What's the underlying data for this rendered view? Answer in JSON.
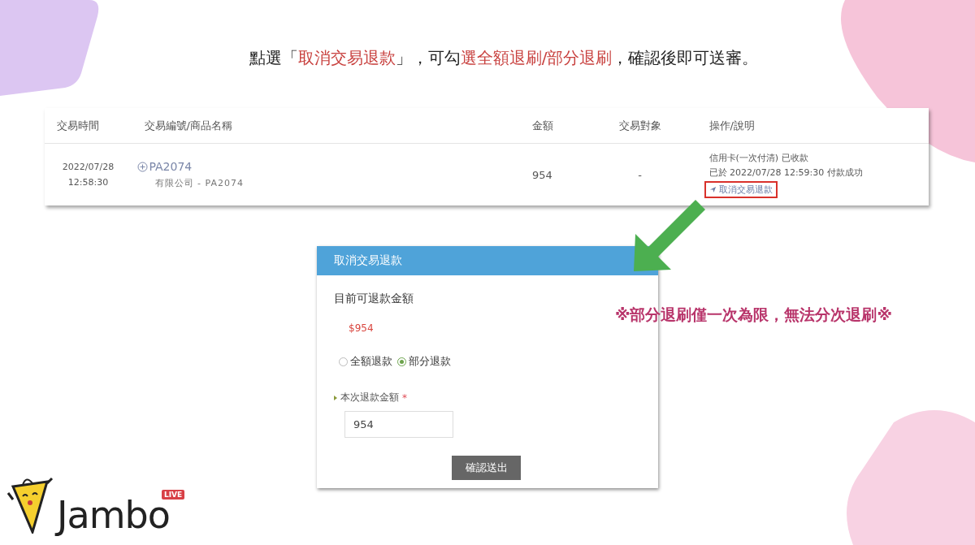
{
  "headline": [
    {
      "text": "點選「",
      "highlight": false
    },
    {
      "text": "取消交易退款",
      "highlight": true
    },
    {
      "text": "」，可勾",
      "highlight": false
    },
    {
      "text": "選全額退刷/部分退刷",
      "highlight": true
    },
    {
      "text": "，確認後即可送審。",
      "highlight": false
    }
  ],
  "table": {
    "columns": [
      "交易時間",
      "交易編號/商品名稱",
      "金額",
      "交易對象",
      "操作/說明"
    ],
    "rows": [
      {
        "date": "2022/07/28",
        "time": "12:58:30",
        "order_id": "PA2074",
        "product": "有限公司 - PA2074",
        "amount": "954",
        "party": "-",
        "status_lines": [
          "信用卡(一次付清) 已收款",
          "已於 2022/07/28 12:59:30 付款成功"
        ],
        "action": "取消交易退款"
      }
    ]
  },
  "dialog": {
    "title": "取消交易退款",
    "refundable_label": "目前可退款金額",
    "refundable_amount": "$954",
    "options": [
      {
        "label": "全額退款",
        "selected": false
      },
      {
        "label": "部分退款",
        "selected": true
      }
    ],
    "amount_label": "本次退款金額",
    "required_mark": "*",
    "amount_value": "954",
    "submit": "確認送出"
  },
  "note": "※部分退刷僅一次為限，無法分次退刷※",
  "logo": {
    "name": "Jambo",
    "badge": "LIVE"
  }
}
